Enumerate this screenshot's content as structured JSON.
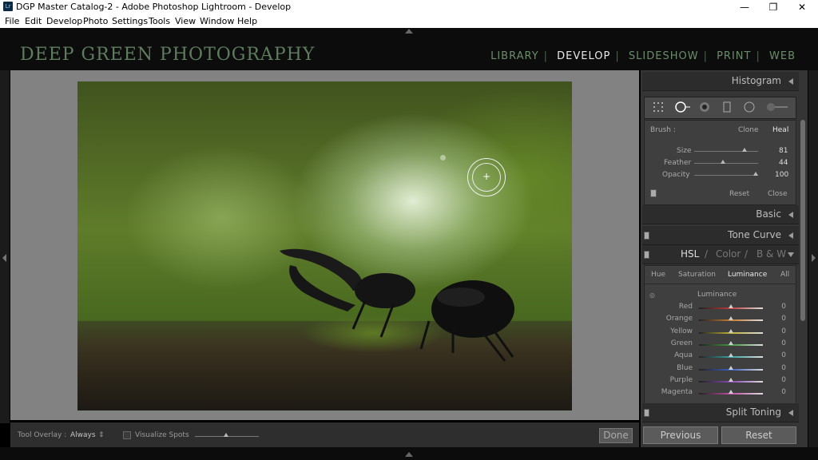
{
  "window": {
    "title": "DGP Master Catalog-2 - Adobe Photoshop Lightroom - Develop",
    "app_icon": "Lr",
    "controls": {
      "minimize": "—",
      "maximize": "❐",
      "close": "✕"
    }
  },
  "menu": [
    "File",
    "Edit",
    "Develop",
    "Photo",
    "Settings",
    "Tools",
    "View",
    "Window",
    "Help"
  ],
  "brand": "DEEP GREEN PHOTOGRAPHY",
  "modules": {
    "items": [
      "LIBRARY",
      "DEVELOP",
      "SLIDESHOW",
      "PRINT",
      "WEB"
    ],
    "separator": "|",
    "active": "DEVELOP"
  },
  "toolbar": {
    "tool_overlay_label": "Tool Overlay :",
    "tool_overlay_value": "Always",
    "tool_overlay_chevron": "⇕",
    "visualize_spots_label": "Visualize Spots",
    "visualize_spots_checked": false,
    "done_label": "Done"
  },
  "panels": {
    "histogram": "Histogram",
    "basic": "Basic",
    "tone_curve": "Tone Curve",
    "split_toning": "Split Toning"
  },
  "tools": [
    "grid-icon",
    "spot-removal-icon",
    "red-eye-icon",
    "graduated-filter-icon",
    "radial-filter-icon",
    "adjustment-brush-icon"
  ],
  "brush": {
    "label": "Brush :",
    "clone": "Clone",
    "heal": "Heal",
    "active": "Heal",
    "sliders": [
      {
        "label": "Size",
        "value": "81",
        "level": 0.81
      },
      {
        "label": "Feather",
        "value": "44",
        "level": 0.44
      },
      {
        "label": "Opacity",
        "value": "100",
        "level": 1.0
      }
    ],
    "reset": "Reset",
    "close": "Close"
  },
  "hsl": {
    "header": {
      "hsl": "HSL",
      "sep": "/",
      "color": "Color",
      "bw": "B & W"
    },
    "tabs": [
      "Hue",
      "Saturation",
      "Luminance",
      "All"
    ],
    "active_tab": "Luminance",
    "section_title": "Luminance",
    "rows": [
      {
        "label": "Red",
        "value": "0",
        "color": "#c23a3a"
      },
      {
        "label": "Orange",
        "value": "0",
        "color": "#c97a2c"
      },
      {
        "label": "Yellow",
        "value": "0",
        "color": "#bfb330"
      },
      {
        "label": "Green",
        "value": "0",
        "color": "#3f9a3f"
      },
      {
        "label": "Aqua",
        "value": "0",
        "color": "#37a3a3"
      },
      {
        "label": "Blue",
        "value": "0",
        "color": "#3a5fc4"
      },
      {
        "label": "Purple",
        "value": "0",
        "color": "#8a45b8"
      },
      {
        "label": "Magenta",
        "value": "0",
        "color": "#c24da6"
      }
    ]
  },
  "nav": {
    "previous": "Previous",
    "reset": "Reset"
  }
}
